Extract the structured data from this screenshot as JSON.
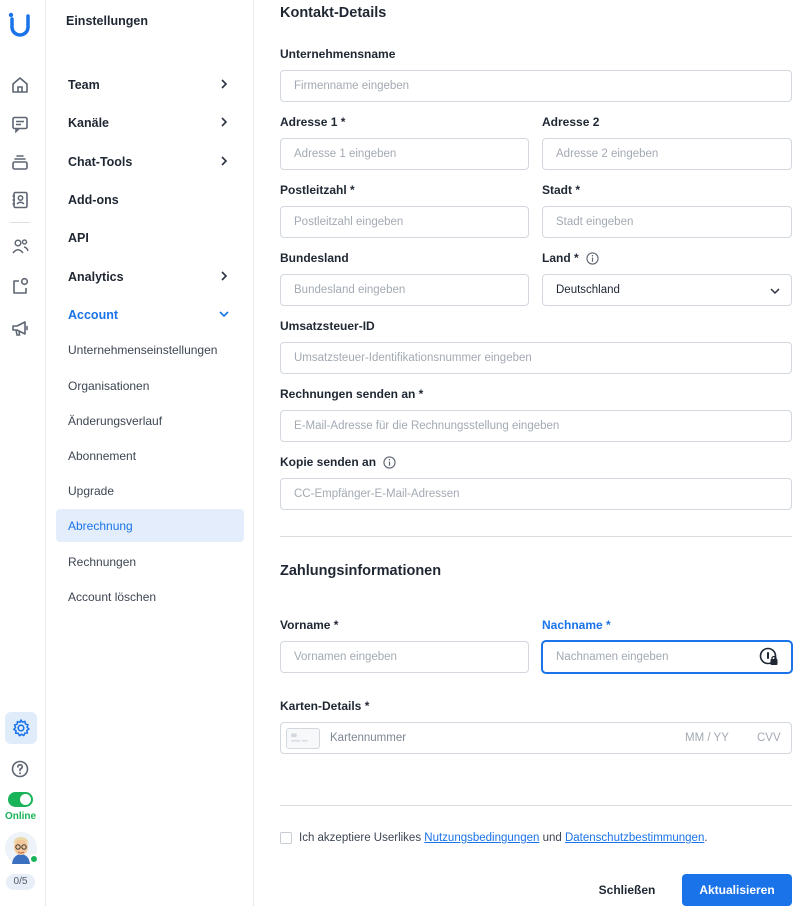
{
  "rail": {
    "icons": [
      "logo-icon",
      "home-icon",
      "inbox-icon",
      "stack-icon",
      "contacts-icon",
      "team-icon",
      "integrations-icon",
      "campaigns-icon",
      "settings-icon",
      "help-icon"
    ],
    "status_label": "Online",
    "counter": "0/5"
  },
  "sidebar": {
    "title": "Einstellungen",
    "items": [
      {
        "label": "Team",
        "has_chevron": true
      },
      {
        "label": "Kanäle",
        "has_chevron": true
      },
      {
        "label": "Chat-Tools",
        "has_chevron": true
      },
      {
        "label": "Add-ons",
        "has_chevron": false
      },
      {
        "label": "API",
        "has_chevron": false
      },
      {
        "label": "Analytics",
        "has_chevron": true
      },
      {
        "label": "Account",
        "expanded": true
      }
    ],
    "sub_items": [
      {
        "label": "Unternehmenseinstellungen"
      },
      {
        "label": "Organisationen"
      },
      {
        "label": "Änderungsverlauf"
      },
      {
        "label": "Abonnement"
      },
      {
        "label": "Upgrade"
      },
      {
        "label": "Abrechnung",
        "active": true
      },
      {
        "label": "Rechnungen"
      },
      {
        "label": "Account löschen"
      }
    ]
  },
  "form": {
    "contact_title": "Kontakt-Details",
    "company": {
      "label": "Unternehmensname",
      "placeholder": "Firmenname eingeben"
    },
    "address1": {
      "label": "Adresse 1 *",
      "placeholder": "Adresse 1 eingeben"
    },
    "address2": {
      "label": "Adresse 2",
      "placeholder": "Adresse 2 eingeben"
    },
    "postcode": {
      "label": "Postleitzahl *",
      "placeholder": "Postleitzahl eingeben"
    },
    "city": {
      "label": "Stadt *",
      "placeholder": "Stadt eingeben"
    },
    "state": {
      "label": "Bundesland",
      "placeholder": "Bundesland eingeben"
    },
    "country": {
      "label": "Land *",
      "value": "Deutschland"
    },
    "vat": {
      "label": "Umsatzsteuer-ID",
      "placeholder": "Umsatzsteuer-Identifikationsnummer eingeben"
    },
    "invoice_email": {
      "label": "Rechnungen senden an *",
      "placeholder": "E-Mail-Adresse für die Rechnungsstellung eingeben"
    },
    "cc_email": {
      "label": "Kopie senden an",
      "placeholder": "CC-Empfänger-E-Mail-Adressen"
    },
    "payment_title": "Zahlungsinformationen",
    "first_name": {
      "label": "Vorname *",
      "placeholder": "Vornamen eingeben"
    },
    "last_name": {
      "label": "Nachname *",
      "placeholder": "Nachnamen eingeben"
    },
    "card": {
      "label": "Karten-Details *",
      "number_placeholder": "Kartennummer",
      "expiry_placeholder": "MM / YY",
      "cvv_placeholder": "CVV"
    },
    "terms": {
      "prefix": "Ich akzeptiere Userlikes",
      "link1": "Nutzungsbedingungen",
      "middle": "und",
      "link2": "Datenschutzbestimmungen",
      "suffix": "."
    }
  },
  "actions": {
    "close_label": "Schließen",
    "update_label": "Aktualisieren"
  },
  "colors": {
    "accent": "#1a73e8",
    "online": "#19b35a",
    "active_bg": "#e3edfb"
  }
}
